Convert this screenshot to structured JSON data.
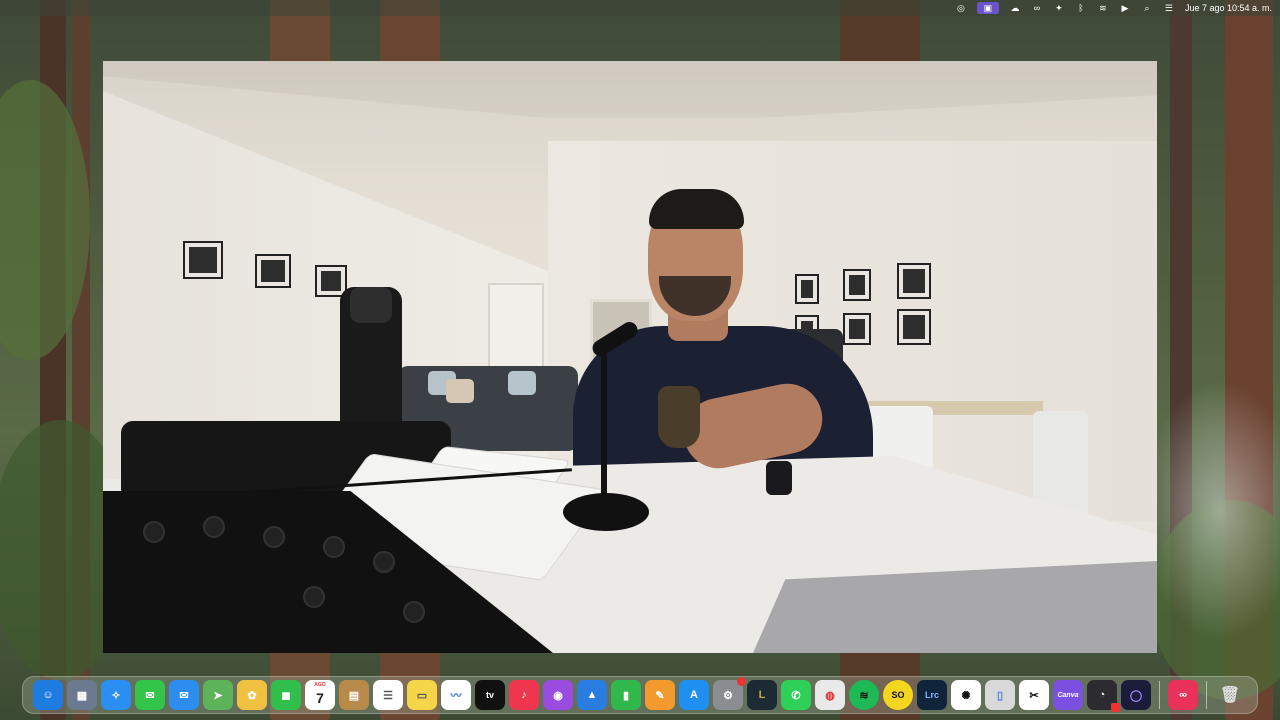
{
  "menubar": {
    "apple_glyph": "",
    "datetime": "Jue 7 ago  10:54 a. m."
  },
  "status_icons": [
    {
      "name": "screen-record-icon",
      "glyph": "◎"
    },
    {
      "name": "screen-mirror-icon",
      "glyph": "▣"
    },
    {
      "name": "cloud-icon",
      "glyph": "☁"
    },
    {
      "name": "creative-cloud-icon",
      "glyph": "∞"
    },
    {
      "name": "shortcuts-icon",
      "glyph": "✦"
    },
    {
      "name": "bluetooth-icon",
      "glyph": "ᛒ"
    },
    {
      "name": "wifi-icon",
      "glyph": "≋"
    },
    {
      "name": "now-playing-icon",
      "glyph": "▶"
    },
    {
      "name": "spotlight-search-icon",
      "glyph": "⌕"
    },
    {
      "name": "control-center-icon",
      "glyph": "☰"
    }
  ],
  "calendar_icon": {
    "month": "AGO",
    "day": "7"
  },
  "dock": [
    {
      "name": "finder",
      "glyph": "☺",
      "color": "#1e7be0"
    },
    {
      "name": "launchpad",
      "glyph": "▦",
      "color": "#6b7a8f"
    },
    {
      "name": "safari",
      "glyph": "✧",
      "color": "#2a8ff0"
    },
    {
      "name": "messages",
      "glyph": "✉",
      "color": "#33c44a"
    },
    {
      "name": "mail",
      "glyph": "✉",
      "color": "#2d8cf0"
    },
    {
      "name": "maps",
      "glyph": "➤",
      "color": "#5db35a"
    },
    {
      "name": "photos",
      "glyph": "✿",
      "color": "#f0c040"
    },
    {
      "name": "facetime",
      "glyph": "◼",
      "color": "#2fbf4a"
    },
    {
      "name": "calendar",
      "glyph": "",
      "color": "#ffffff"
    },
    {
      "name": "notes-app",
      "glyph": "▤",
      "color": "#b78a4a"
    },
    {
      "name": "reminders",
      "glyph": "☰",
      "color": "#ffffff"
    },
    {
      "name": "notes",
      "glyph": "▭",
      "color": "#f5d54a"
    },
    {
      "name": "freeform",
      "glyph": "〰",
      "color": "#ffffff"
    },
    {
      "name": "apple-tv",
      "glyph": "tv",
      "color": "#111111"
    },
    {
      "name": "music",
      "glyph": "♪",
      "color": "#f0364e"
    },
    {
      "name": "podcasts",
      "glyph": "◉",
      "color": "#9b4ce0"
    },
    {
      "name": "keynote",
      "glyph": "▲",
      "color": "#2a7de0"
    },
    {
      "name": "numbers",
      "glyph": "▮",
      "color": "#30b94a"
    },
    {
      "name": "pages",
      "glyph": "✎",
      "color": "#f29a2e"
    },
    {
      "name": "app-store",
      "glyph": "A",
      "color": "#1f8ff2"
    },
    {
      "name": "system-settings",
      "glyph": "⚙",
      "color": "#8a8d92"
    },
    {
      "name": "league-of-legends",
      "glyph": "L",
      "color": "#1c2a33"
    },
    {
      "name": "whatsapp",
      "glyph": "✆",
      "color": "#2fd058"
    },
    {
      "name": "chrome",
      "glyph": "◍",
      "color": "#e9e9e9"
    },
    {
      "name": "spotify",
      "glyph": "≋",
      "color": "#1db954"
    },
    {
      "name": "soda",
      "glyph": "SO",
      "color": "#f4d620"
    },
    {
      "name": "lightroom-classic",
      "glyph": "Lrc",
      "color": "#10243b"
    },
    {
      "name": "chatgpt",
      "glyph": "✺",
      "color": "#ffffff"
    },
    {
      "name": "preview",
      "glyph": "▯",
      "color": "#d9d9d9"
    },
    {
      "name": "capcut",
      "glyph": "✂",
      "color": "#ffffff"
    },
    {
      "name": "canva",
      "glyph": "Canva",
      "color": "#7b4fe0"
    },
    {
      "name": "obs",
      "glyph": "◔",
      "color": "#2b2b30"
    },
    {
      "name": "arc",
      "glyph": "◯",
      "color": "#1b1c3a"
    },
    {
      "name": "creative-cloud",
      "glyph": "∞",
      "color": "#e8325a"
    },
    {
      "name": "trash",
      "glyph": "🗑",
      "color": "transparent"
    }
  ]
}
